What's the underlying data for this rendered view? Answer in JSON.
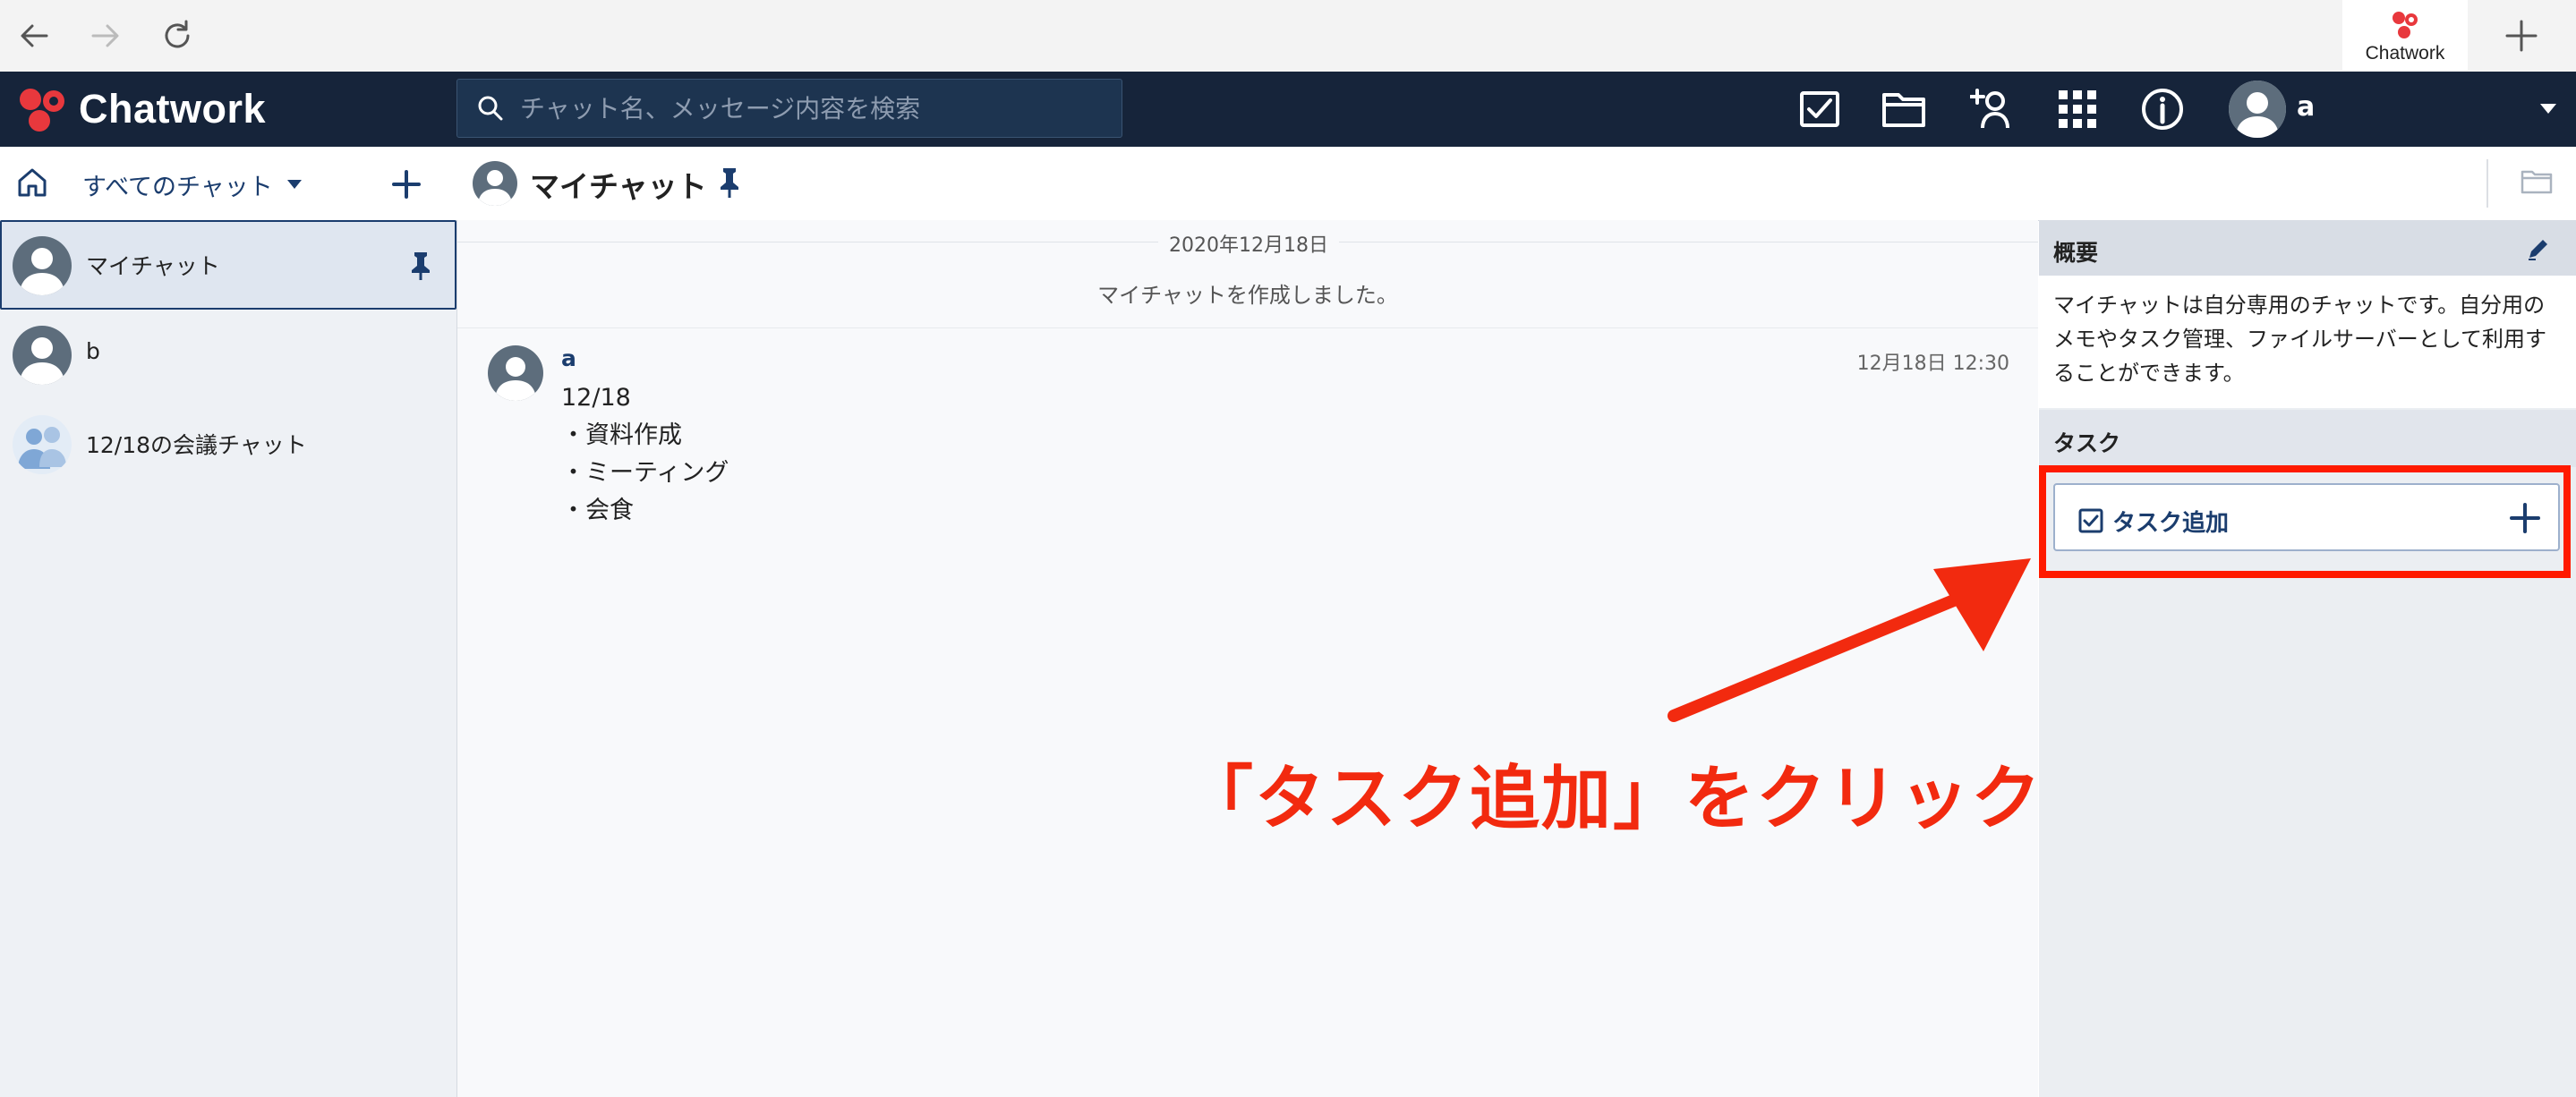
{
  "browser": {
    "tab_title": "Chatwork",
    "icons": [
      "back-arrow-icon",
      "forward-arrow-icon",
      "reload-icon",
      "new-tab-plus-icon"
    ]
  },
  "header": {
    "logo_text": "Chatwork",
    "search_placeholder": "チャット名、メッセージ内容を検索",
    "icons": [
      "task-check-icon",
      "folder-icon",
      "add-contact-icon",
      "apps-grid-icon",
      "info-icon"
    ],
    "user_name": "a"
  },
  "toolbar": {
    "all_chats_label": "すべてのチャット"
  },
  "room": {
    "title": "マイチャット"
  },
  "sidebar": {
    "items": [
      {
        "label": "マイチャット",
        "selected": true,
        "pinned": true
      },
      {
        "label": "b",
        "selected": false,
        "pinned": false
      },
      {
        "label": "12/18の会議チャット",
        "selected": false,
        "pinned": false
      }
    ]
  },
  "timeline": {
    "date": "2020年12月18日",
    "system_message": "マイチャットを作成しました。",
    "messages": [
      {
        "author": "a",
        "time": "12月18日 12:30",
        "lines": [
          "12/18",
          "・資料作成",
          "・ミーティング",
          "・会食"
        ]
      }
    ]
  },
  "right_panel": {
    "overview_title": "概要",
    "overview_text": "マイチャットは自分専用のチャットです。自分用のメモやタスク管理、ファイルサーバーとして利用することができます。",
    "task_title": "タスク",
    "add_task_label": "タスク追加"
  },
  "annotation": {
    "text": "「タスク追加」をクリック",
    "color": "#f22a0f"
  },
  "colors": {
    "header_bg": "#16243a",
    "accent": "#1b3d6e",
    "highlight": "#ff1a00"
  }
}
